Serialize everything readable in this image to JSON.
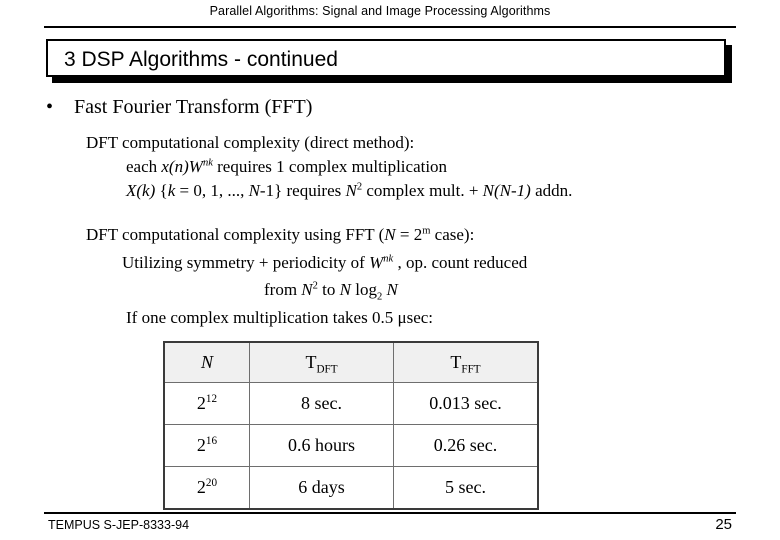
{
  "header": {
    "text": "Parallel Algorithms:  Signal and Image Processing Algorithms"
  },
  "title": {
    "number": "3",
    "text": "3  DSP Algorithms - continued"
  },
  "bullet": {
    "marker": "•",
    "label": "Fast Fourier Transform (FFT)"
  },
  "paragraph1": {
    "line1": "DFT computational complexity (direct method):",
    "line2_pre": "each ",
    "line2_x": "x(n)",
    "line2_w": "W",
    "line2_w_sup": "nk",
    "line2_post": " requires 1  complex multiplication",
    "line3_x": "X(k)",
    "line3_a": " {",
    "line3_k": "k",
    "line3_b": " = 0, 1, ..., ",
    "line3_n1": "N",
    "line3_c": "‑1} requires ",
    "line3_n2": "N",
    "line3_n2_sup": "2",
    "line3_d": " complex mult. + ",
    "line3_n3": "N(N",
    "line3_e": "‑1)",
    "line3_f": " addn."
  },
  "paragraph2": {
    "line1_pre": "DFT computational complexity using FFT (",
    "line1_n": "N",
    "line1_mid": " = 2",
    "line1_sup": "m",
    "line1_post": " case):",
    "line2_pre": "Utilizing symmetry + periodicity of  ",
    "line2_w": "W",
    "line2_w_sup": "nk",
    "line2_post": " , op. count  reduced",
    "line3_pre": "from ",
    "line3_n1": "N",
    "line3_n1_sup": "2",
    "line3_mid": " to  ",
    "line3_n2": "N",
    "line3_log": " log",
    "line3_log_sub": "2",
    "line3_n3": " N"
  },
  "paragraph3": {
    "line1_pre": "If one complex multiplication takes 0.5 ",
    "line1_mu": "μ",
    "line1_post": "sec:"
  },
  "table": {
    "headers": {
      "col1": "N",
      "col2_base": "T",
      "col2_sub": "DFT",
      "col3_base": "T",
      "col3_sub": "FFT"
    },
    "rows": [
      {
        "n_base": "2",
        "n_exp": "12",
        "t_dft": "8 sec.",
        "t_fft": "0.013 sec."
      },
      {
        "n_base": "2",
        "n_exp": "16",
        "t_dft": "0.6 hours",
        "t_fft": "0.26 sec."
      },
      {
        "n_base": "2",
        "n_exp": "20",
        "t_dft": "6 days",
        "t_fft": "5 sec."
      }
    ]
  },
  "footer": {
    "left": "TEMPUS S-JEP-8333-94",
    "page": "25"
  },
  "colors": {
    "background": "#ffffff",
    "text": "#000000",
    "rule": "#000000",
    "table_header_fill": "#f0f0f0",
    "table_border": "#6e6e6e",
    "table_outer_border": "#3a3a3a"
  }
}
